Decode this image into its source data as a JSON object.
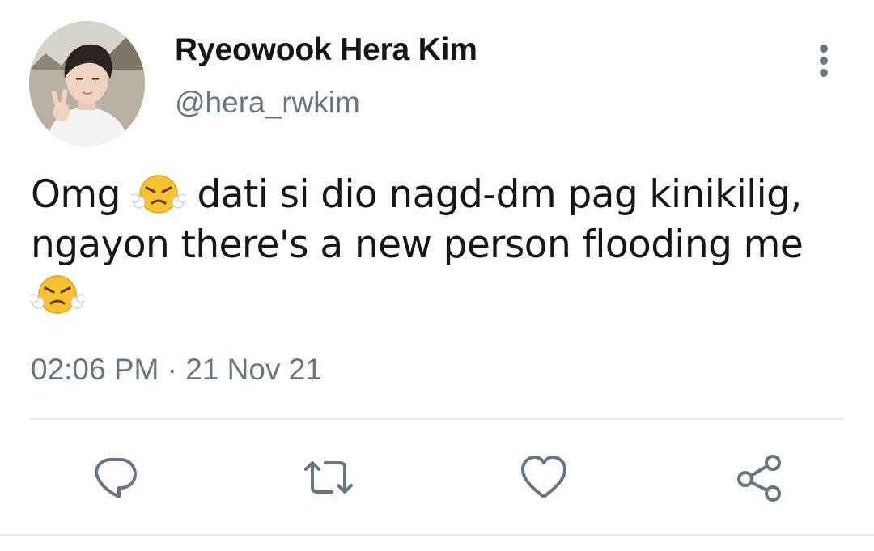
{
  "user": {
    "display_name": "Ryeowook Hera Kim",
    "handle": "@hera_rwkim"
  },
  "tweet": {
    "line1_before_emoji": "Omg ",
    "line1_after_emoji": " dati si dio nagd-dm pag kinikilig,",
    "line2": "ngayon there's a new person flooding me",
    "emoji": "face-with-steam-from-nose",
    "timestamp": "02:06 PM · 21 Nov 21"
  },
  "actions": [
    "reply",
    "retweet",
    "like",
    "share"
  ],
  "colors": {
    "text": "#14171a",
    "secondary_text": "#657786",
    "icon": "#657786",
    "divider": "#e6ecf0"
  }
}
